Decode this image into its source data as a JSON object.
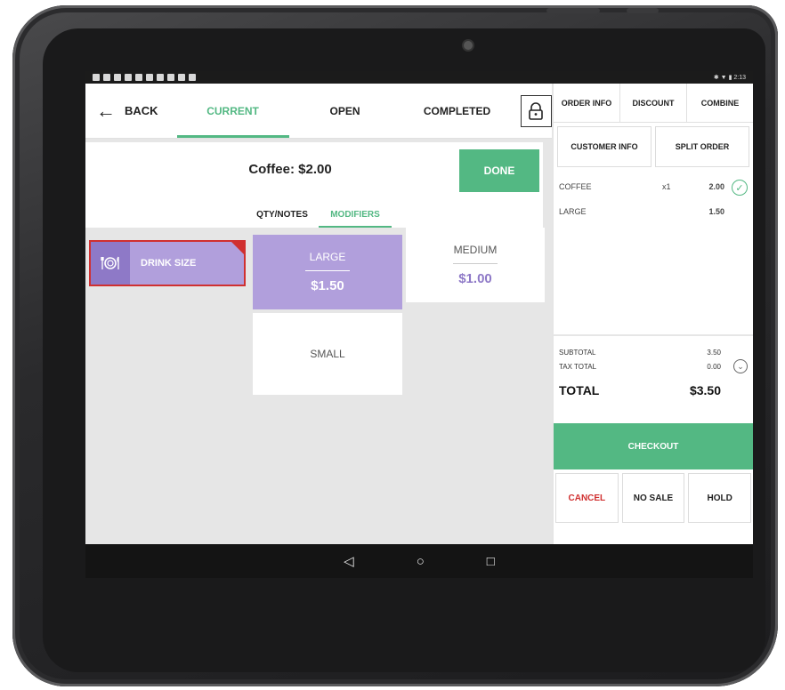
{
  "status": {
    "time": "2:13"
  },
  "nav": {
    "back_label": "BACK",
    "tabs": [
      {
        "label": "CURRENT",
        "active": true
      },
      {
        "label": "OPEN",
        "active": false
      },
      {
        "label": "COMPLETED",
        "active": false
      }
    ]
  },
  "item": {
    "title": "Coffee: $2.00",
    "done_label": "DONE",
    "subtabs": [
      {
        "label": "QTY/NOTES",
        "active": false
      },
      {
        "label": "MODIFIERS",
        "active": true
      }
    ]
  },
  "category": {
    "label": "DRINK SIZE",
    "icon": "utensils-icon"
  },
  "modifiers": [
    {
      "name": "LARGE",
      "price": "$1.50",
      "selected": true
    },
    {
      "name": "MEDIUM",
      "price": "$1.00",
      "selected": false
    },
    {
      "name": "SMALL",
      "price": "",
      "selected": false
    }
  ],
  "order_panel": {
    "tabs": [
      "ORDER INFO",
      "DISCOUNT",
      "COMBINE"
    ],
    "buttons": [
      "CUSTOMER INFO",
      "SPLIT ORDER"
    ],
    "lines": [
      {
        "name": "COFFEE",
        "qty": "x1",
        "amount": "2.00"
      },
      {
        "name": "LARGE",
        "qty": "",
        "amount": "1.50"
      }
    ],
    "subtotal_label": "SUBTOTAL",
    "subtotal": "3.50",
    "tax_label": "TAX TOTAL",
    "tax": "0.00",
    "total_label": "TOTAL",
    "total": "$3.50",
    "checkout_label": "CHECKOUT",
    "actions": [
      "CANCEL",
      "NO SALE",
      "HOLD"
    ]
  },
  "colors": {
    "accent": "#53b883",
    "modifier": "#b19fdc",
    "alert": "#d03030"
  }
}
